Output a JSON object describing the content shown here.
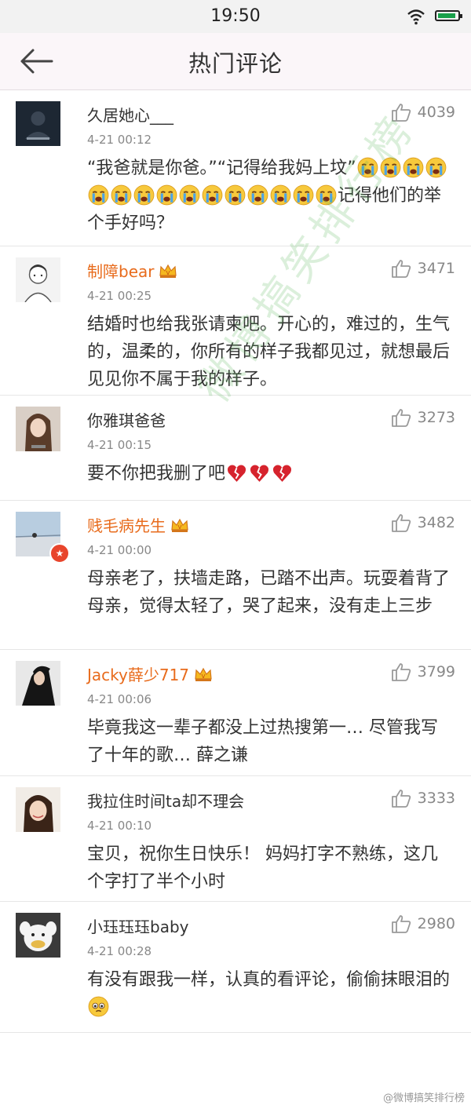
{
  "status_bar": {
    "time": "19:50"
  },
  "header": {
    "title": "热门评论"
  },
  "comments": [
    {
      "username": "久居她心___",
      "date": "4-21 00:12",
      "likes": "4039",
      "vip": false,
      "text_before": "“我爸就是你爸。”“记得给我妈上坟”",
      "emoji_a": "loudly-crying",
      "emoji_a_count": 15,
      "text_after": "记得他们的举个手好吗？"
    },
    {
      "username": "制障bear",
      "date": "4-21 00:25",
      "likes": "3471",
      "vip": true,
      "text": "结婚时也给我张请柬吧。开心的，难过的，生气的，温柔的，你所有的样子我都见过，就想最后见见你不属于我的样子。"
    },
    {
      "username": "你雅琪爸爸",
      "date": "4-21 00:15",
      "likes": "3273",
      "vip": false,
      "text": "要不你把我删了吧",
      "emoji": "broken-heart",
      "emoji_count": 3
    },
    {
      "username": "贱毛病先生",
      "date": "4-21 00:00",
      "likes": "3482",
      "vip": true,
      "verified": true,
      "text": "母亲老了，扶墙走路，已踏不出声。玩耍着背了母亲，觉得太轻了，哭了起来，没有走上三步"
    },
    {
      "username": "Jacky薛少717",
      "date": "4-21 00:06",
      "likes": "3799",
      "vip": true,
      "text": "毕竟我这一辈子都没上过热搜第一… 尽管我写了十年的歌… 薛之谦"
    },
    {
      "username": "我拉住时间ta却不理会",
      "date": "4-21 00:10",
      "likes": "3333",
      "vip": false,
      "text": "宝贝，祝你生日快乐！ 妈妈打字不熟练，这几个字打了半个小时"
    },
    {
      "username": "小珏珏珏baby",
      "date": "4-21 00:28",
      "likes": "2980",
      "vip": false,
      "text": "有没有跟我一样，认真的看评论，偷偷抹眼泪的",
      "emoji": "teary-eyes",
      "emoji_count": 1
    }
  ],
  "watermark": "微博搞笑排行榜",
  "footer": {
    "credit": "@微博搞笑排行榜"
  },
  "colors": {
    "vip_name": "#e86b1c",
    "nav_bg": "#fbf6f9",
    "status_bg": "#f2f2f2"
  }
}
